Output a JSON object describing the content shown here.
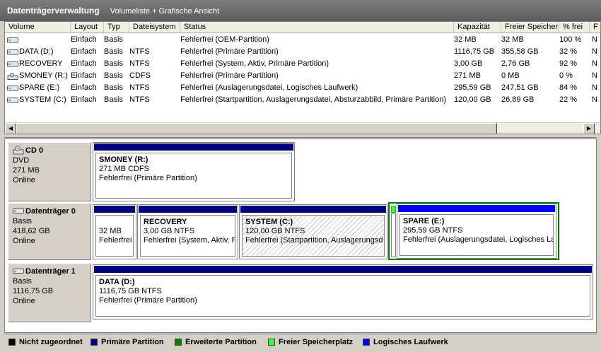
{
  "window": {
    "title": "Datenträgerverwaltung",
    "view": "Volumeliste + Grafische Ansicht"
  },
  "volume_list": {
    "columns": [
      "Volume",
      "Layout",
      "Typ",
      "Dateisystem",
      "Status",
      "Kapazität",
      "Freier Speicher",
      "% frei",
      "F"
    ],
    "rows": [
      {
        "icon": "disk-volume-icon",
        "volume": "",
        "layout": "Einfach",
        "typ": "Basis",
        "fs": "",
        "status": "Fehlerfrei (OEM-Partition)",
        "cap": "32 MB",
        "free": "32 MB",
        "pct": "100 %",
        "f": "N"
      },
      {
        "icon": "disk-volume-icon",
        "volume": "DATA (D:)",
        "layout": "Einfach",
        "typ": "Basis",
        "fs": "NTFS",
        "status": "Fehlerfrei (Primäre Partition)",
        "cap": "1116,75 GB",
        "free": "355,58 GB",
        "pct": "32 %",
        "f": "N"
      },
      {
        "icon": "disk-volume-icon",
        "volume": "RECOVERY",
        "layout": "Einfach",
        "typ": "Basis",
        "fs": "NTFS",
        "status": "Fehlerfrei (System, Aktiv, Primäre Partition)",
        "cap": "3,00 GB",
        "free": "2,76 GB",
        "pct": "92 %",
        "f": "N"
      },
      {
        "icon": "cd-volume-icon",
        "volume": "SMONEY (R:)",
        "layout": "Einfach",
        "typ": "Basis",
        "fs": "CDFS",
        "status": "Fehlerfrei (Primäre Partition)",
        "cap": "271 MB",
        "free": "0 MB",
        "pct": "0 %",
        "f": "N"
      },
      {
        "icon": "disk-volume-icon",
        "volume": "SPARE (E:)",
        "layout": "Einfach",
        "typ": "Basis",
        "fs": "NTFS",
        "status": "Fehlerfrei (Auslagerungsdatei, Logisches Laufwerk)",
        "cap": "295,59 GB",
        "free": "247,51 GB",
        "pct": "84 %",
        "f": "N"
      },
      {
        "icon": "disk-volume-icon",
        "volume": "SYSTEM (C:)",
        "layout": "Einfach",
        "typ": "Basis",
        "fs": "NTFS",
        "status": "Fehlerfrei (Startpartition, Auslagerungsdatei, Absturzabbild, Primäre Partition)",
        "cap": "120,00 GB",
        "free": "26,89 GB",
        "pct": "22 %",
        "f": "N"
      }
    ]
  },
  "disks": [
    {
      "name": "CD 0",
      "type": "DVD",
      "size": "271 MB",
      "state": "Online",
      "icon": "cd-drive-icon",
      "partitions": [
        {
          "name": "SMONEY  (R:)",
          "line1": "271 MB CDFS",
          "line2": "Fehlerfrei (Primäre Partition)",
          "color": "#000080"
        }
      ]
    },
    {
      "name": "Datenträger 0",
      "type": "Basis",
      "size": "418,62 GB",
      "state": "Online",
      "icon": "hard-disk-icon",
      "partitions": [
        {
          "name": "",
          "line1": "32 MB",
          "line2": "Fehlerfrei",
          "color": "#000080"
        },
        {
          "name": "RECOVERY",
          "line1": "3,00 GB NTFS",
          "line2": "Fehlerfrei (System, Aktiv, P",
          "color": "#000080"
        },
        {
          "name": "SYSTEM  (C:)",
          "line1": "120,00 GB NTFS",
          "line2": "Fehlerfrei (Startpartition, Auslagerungsd",
          "color": "#000080"
        },
        {
          "name": "SPARE  (E:)",
          "line1": "295,59 GB NTFS",
          "line2": "Fehlerfrei (Auslagerungsdatei, Logisches La",
          "color": "#0000ff"
        }
      ]
    },
    {
      "name": "Datenträger 1",
      "type": "Basis",
      "size": "1116,75 GB",
      "state": "Online",
      "icon": "hard-disk-icon",
      "partitions": [
        {
          "name": "DATA  (D:)",
          "line1": "1116,75 GB NTFS",
          "line2": "Fehlerfrei (Primäre Partition)",
          "color": "#000080"
        }
      ]
    }
  ],
  "legend": [
    {
      "label": "Nicht zugeordnet",
      "color": "#000000"
    },
    {
      "label": "Primäre Partition",
      "color": "#000080"
    },
    {
      "label": "Erweiterte Partition",
      "color": "#008000"
    },
    {
      "label": "Freier Speicherplatz",
      "color": "#33ff33"
    },
    {
      "label": "Logisches Laufwerk",
      "color": "#0000ff"
    }
  ],
  "colors": {
    "extended_border": "#008000",
    "free_space": "#33ff33"
  }
}
